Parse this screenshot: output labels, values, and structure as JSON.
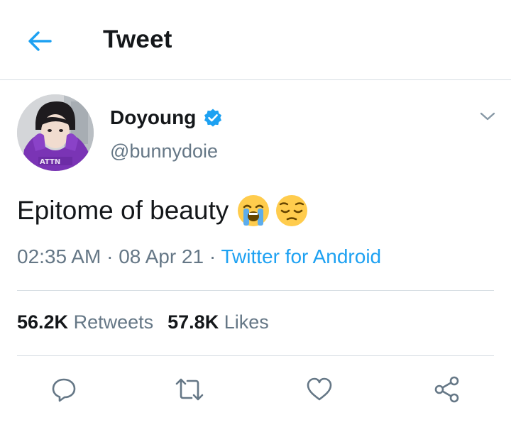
{
  "header": {
    "title": "Tweet",
    "back_icon": "arrow-left-icon"
  },
  "author": {
    "display_name": "Doyoung",
    "handle": "@bunnydoie",
    "verified": true,
    "avatar_shirt_text": "ATTN"
  },
  "tweet": {
    "text": "Epitome of beauty",
    "emojis": [
      "loudly-crying-face",
      "pensive-face"
    ]
  },
  "meta": {
    "time": "02:35 AM",
    "sep1": " · ",
    "date": "08 Apr 21",
    "sep2": " · ",
    "client": "Twitter for Android"
  },
  "stats": {
    "retweets_count": "56.2K",
    "retweets_label": "Retweets",
    "likes_count": "57.8K",
    "likes_label": "Likes"
  },
  "actions": [
    "reply-icon",
    "retweet-icon",
    "like-icon",
    "share-icon"
  ],
  "colors": {
    "accent": "#1da1f2",
    "text_primary": "#14171a",
    "text_secondary": "#657786",
    "divider": "#d7dee3"
  }
}
